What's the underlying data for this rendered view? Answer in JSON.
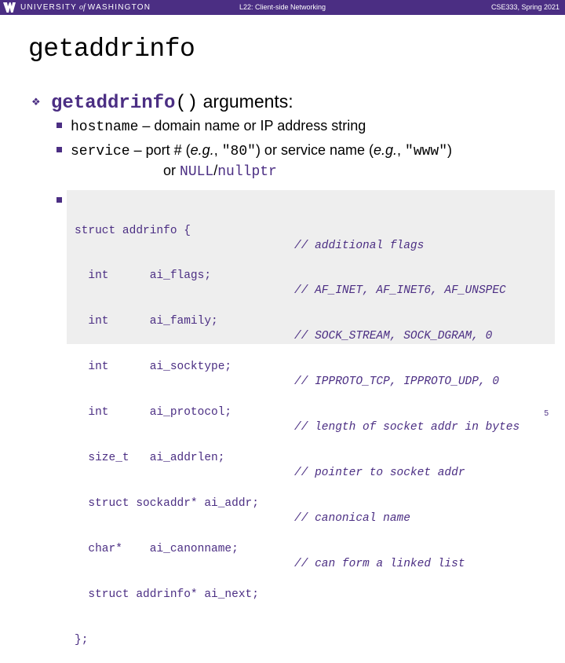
{
  "header": {
    "university_left": "UNIVERSITY",
    "university_of": "of",
    "university_right": "WASHINGTON",
    "lecture": "L22: Client-side Networking",
    "course": "CSE333, Spring 2021"
  },
  "slide": {
    "title": "getaddrinfo",
    "bullet1": {
      "fn": "getaddrinfo",
      "parens": "()",
      "rest": " arguments:"
    },
    "bullet2": {
      "code": "hostname",
      "rest": " – domain name or IP address string"
    },
    "bullet3": {
      "code": "service",
      "t1": " – port # (",
      "eg1": "e.g.",
      "t2": ", ",
      "port": "\"80\"",
      "t3": ") or service name (",
      "eg2": "e.g.",
      "t4": ", ",
      "svc": "\"www\"",
      "t5": ")",
      "cont_or": "or ",
      "null": "NULL",
      "slash": "/",
      "nullptr": "nullptr"
    },
    "code_lines": [
      "struct addrinfo {",
      "  int      ai_flags;",
      "  int      ai_family;",
      "  int      ai_socktype;",
      "  int      ai_protocol;",
      "  size_t   ai_addrlen;",
      "  struct sockaddr* ai_addr;",
      "  char*    ai_canonname;",
      "  struct addrinfo* ai_next;",
      "};"
    ],
    "comment_lines": [
      "// additional flags",
      "// AF_INET, AF_INET6, AF_UNSPEC",
      "// SOCK_STREAM, SOCK_DGRAM, 0",
      "// IPPROTO_TCP, IPPROTO_UDP, 0",
      "// length of socket addr in bytes",
      "// pointer to socket addr",
      "// canonical name",
      "// can form a linked list"
    ],
    "page_number": "5"
  },
  "colors": {
    "brand": "#4b2e83",
    "code_bg": "#eeeeee"
  },
  "icons": [
    "w-logo-icon",
    "diamond-bullet-icon",
    "square-bullet-icon"
  ]
}
